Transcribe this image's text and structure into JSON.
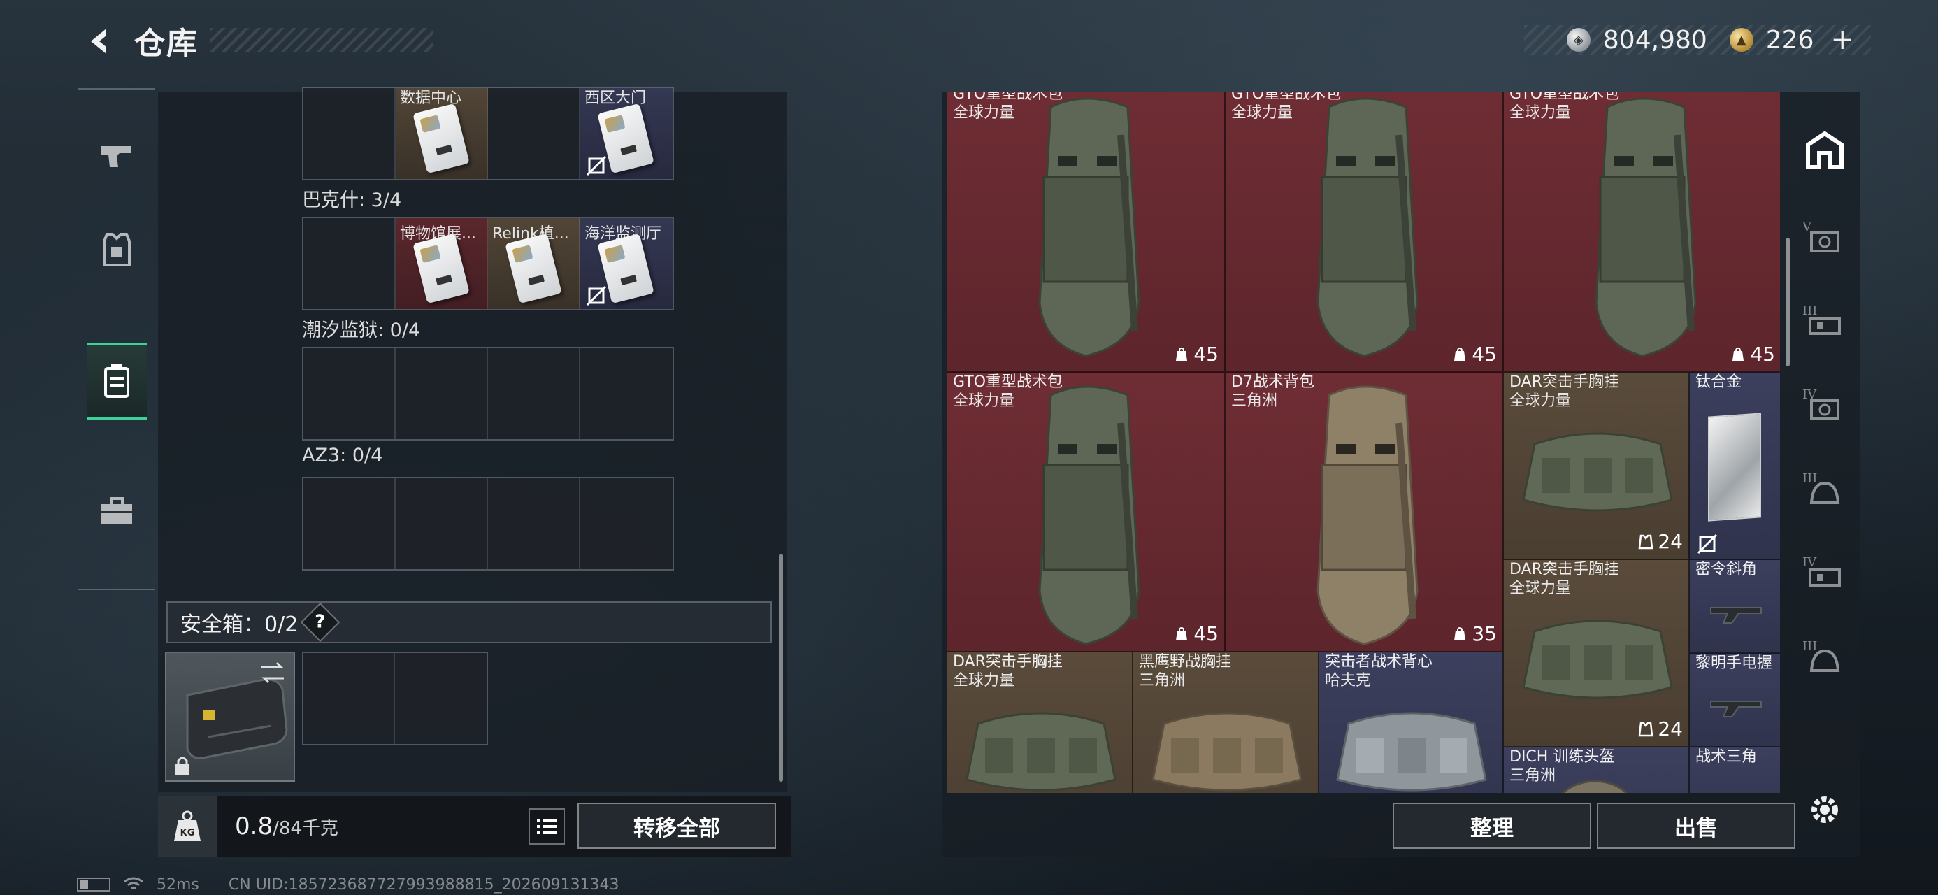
{
  "header": {
    "title": "仓库"
  },
  "currency": [
    {
      "name": "hafu-coin",
      "value": "804,980"
    },
    {
      "name": "triangle-coin",
      "value": "226"
    }
  ],
  "currency_plus": "+",
  "left": {
    "slot_rows": [
      {
        "label": "",
        "slots": [
          {
            "name": "",
            "card": false,
            "color": ""
          },
          {
            "name": "数据中心",
            "card": true,
            "color": "brown"
          },
          {
            "name": "",
            "card": false,
            "color": ""
          },
          {
            "name": "西区大门",
            "card": true,
            "color": "blue",
            "no_trade": true
          }
        ]
      },
      {
        "label": "巴克什: 3/4",
        "slots": [
          {
            "name": "",
            "card": false,
            "color": ""
          },
          {
            "name": "博物馆展...",
            "card": true,
            "color": "red"
          },
          {
            "name": "Relink植...",
            "card": true,
            "color": "brown"
          },
          {
            "name": "海洋监测厅",
            "card": true,
            "color": "blue",
            "no_trade": true
          }
        ]
      },
      {
        "label": "潮汐监狱: 0/4",
        "slots": [
          {
            "name": "",
            "card": false
          },
          {
            "name": "",
            "card": false
          },
          {
            "name": "",
            "card": false
          },
          {
            "name": "",
            "card": false
          }
        ]
      },
      {
        "label": "AZ3: 0/4",
        "slots": [
          {
            "name": "",
            "card": false
          },
          {
            "name": "",
            "card": false
          },
          {
            "name": "",
            "card": false
          },
          {
            "name": "",
            "card": false
          }
        ]
      }
    ],
    "safebox_label": "安全箱：0/2",
    "help": "?",
    "weight_current": "0.8",
    "weight_max": "/84千克",
    "weight_icon_text": "KG",
    "transfer_all": "转移全部"
  },
  "inventory": [
    {
      "name": "GTO重型战术包",
      "sub": "全球力量",
      "color": "red",
      "art": "backpack",
      "badge": "45",
      "badge_icon": "bag-icon"
    },
    {
      "name": "GTO重型战术包",
      "sub": "全球力量",
      "color": "red",
      "art": "backpack",
      "badge": "45",
      "badge_icon": "bag-icon"
    },
    {
      "name": "GTO重型战术包",
      "sub": "全球力量",
      "color": "red",
      "art": "backpack",
      "badge": "45",
      "badge_icon": "bag-icon"
    },
    {
      "name": "GTO重型战术包",
      "sub": "全球力量",
      "color": "red",
      "art": "backpack",
      "badge": "45",
      "badge_icon": "bag-icon"
    },
    {
      "name": "D7战术背包",
      "sub": "三角洲",
      "color": "red",
      "art": "backpack-tan",
      "badge": "35",
      "badge_icon": "bag-icon"
    },
    {
      "name": "DAR突击手胸挂",
      "sub": "全球力量",
      "color": "brown",
      "art": "vest",
      "badge": "24",
      "badge_icon": "vest-icon"
    },
    {
      "name": "钛合金",
      "sub": "",
      "color": "blue",
      "art": "plate",
      "badge": "",
      "no_trade": true
    },
    {
      "name": "DAR突击手胸挂",
      "sub": "全球力量",
      "color": "brown",
      "art": "vest",
      "badge": "24",
      "badge_icon": "vest-icon"
    },
    {
      "name": "密令斜角",
      "sub": "",
      "color": "blue",
      "art": "grip"
    },
    {
      "name": "黎明手电握",
      "sub": "",
      "color": "blue",
      "art": "grip"
    },
    {
      "name": "DAR突击手胸挂",
      "sub": "全球力量",
      "color": "brown",
      "art": "vest"
    },
    {
      "name": "黑鹰野战胸挂",
      "sub": "三角洲",
      "color": "brown",
      "art": "vest-tan"
    },
    {
      "name": "突击者战术背心",
      "sub": "哈夫克",
      "color": "blue",
      "art": "vest-camo"
    },
    {
      "name": "DICH 训练头盔",
      "sub": "三角洲",
      "color": "blue",
      "art": "helmet"
    },
    {
      "name": "战术三角",
      "sub": "",
      "color": "blue",
      "art": "grip"
    }
  ],
  "buttons": {
    "sort": "整理",
    "sell": "出售"
  },
  "right_rail": [
    {
      "icon": "home-icon",
      "roman": ""
    },
    {
      "icon": "armor-icon",
      "roman": "V"
    },
    {
      "icon": "rig-icon",
      "roman": "III"
    },
    {
      "icon": "armor-icon",
      "roman": "IV"
    },
    {
      "icon": "helmet-icon",
      "roman": "III"
    },
    {
      "icon": "rig-icon",
      "roman": "IV"
    },
    {
      "icon": "helmet-icon",
      "roman": "III"
    }
  ],
  "status": {
    "ping": "52ms",
    "uid": "CN UID:185723687727993988815_202609131343"
  },
  "colors": {
    "accent": "#3fd19a",
    "rarity_red": "#6f2d34",
    "rarity_brown": "#5a4b3b",
    "rarity_blue": "#3c3f5d"
  }
}
